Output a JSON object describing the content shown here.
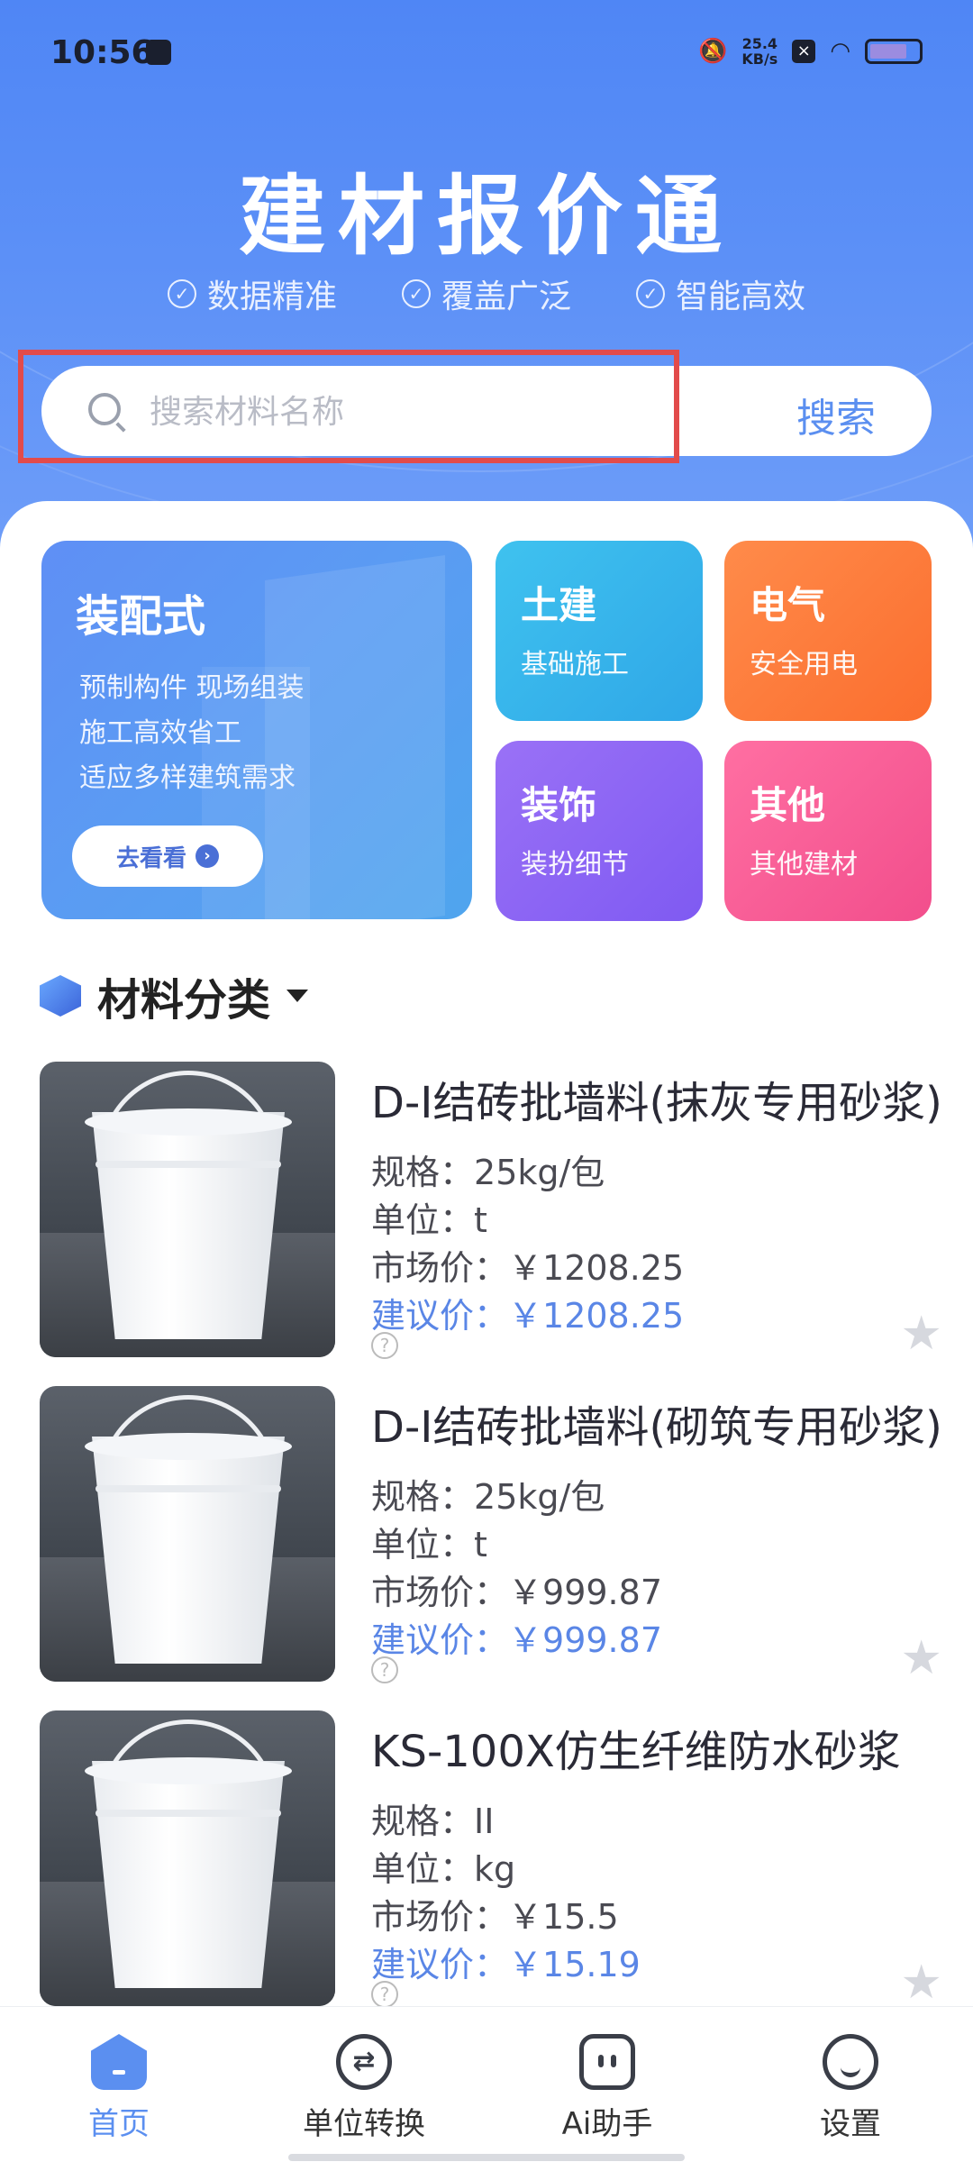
{
  "status": {
    "time": "10:56",
    "speed_value": "25.4",
    "speed_unit": "KB/s"
  },
  "app": {
    "title": "建材报价通"
  },
  "features": [
    "数据精准",
    "覆盖广泛",
    "智能高效"
  ],
  "search": {
    "placeholder": "搜索材料名称",
    "button": "搜索"
  },
  "banner": {
    "title": "装配式",
    "lines": [
      "预制构件 现场组装",
      "施工高效省工",
      "适应多样建筑需求"
    ],
    "cta": "去看看"
  },
  "tiles": [
    {
      "title": "土建",
      "subtitle": "基础施工"
    },
    {
      "title": "电气",
      "subtitle": "安全用电"
    },
    {
      "title": "装饰",
      "subtitle": "装扮细节"
    },
    {
      "title": "其他",
      "subtitle": "其他建材"
    }
  ],
  "section": {
    "title": "材料分类"
  },
  "labels": {
    "spec": "规格：",
    "unit": "单位：",
    "market": "市场价：",
    "suggest": "建议价：",
    "currency": "￥"
  },
  "products": [
    {
      "name": "D-I结砖批墙料(抹灰专用砂浆)",
      "spec": "25kg/包",
      "unit": "t",
      "market": "1208.25",
      "suggest": "1208.25"
    },
    {
      "name": "D-I结砖批墙料(砌筑专用砂浆)",
      "spec": "25kg/包",
      "unit": "t",
      "market": "999.87",
      "suggest": "999.87"
    },
    {
      "name": "KS-100X仿生纤维防水砂浆",
      "spec": "II",
      "unit": "kg",
      "market": "15.5",
      "suggest": "15.19"
    }
  ],
  "nav": {
    "home": "首页",
    "convert": "单位转换",
    "ai": "Ai助手",
    "settings": "设置"
  }
}
